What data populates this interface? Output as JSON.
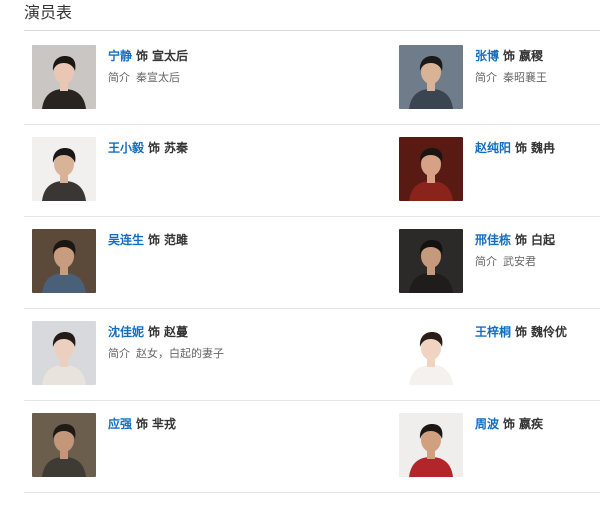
{
  "header": {
    "title": "演员表"
  },
  "connector": "饰",
  "intro_label": "简介",
  "cast": [
    {
      "actor": "宁静",
      "role": "宣太后",
      "intro": "秦宣太后",
      "photo": {
        "bg": "#c9c6c4",
        "skin": "#e9c7b4",
        "hair": "#1d1714",
        "cloth": "#2a2420"
      }
    },
    {
      "actor": "张博",
      "role": "嬴稷",
      "intro": "秦昭襄王",
      "photo": {
        "bg": "#6f7c8a",
        "skin": "#d9b395",
        "hair": "#1c1a19",
        "cloth": "#3b4552"
      }
    },
    {
      "actor": "王小毅",
      "role": "苏秦",
      "intro": "",
      "photo": {
        "bg": "#f1f0ee",
        "skin": "#d8b397",
        "hair": "#1a1817",
        "cloth": "#3a3633"
      }
    },
    {
      "actor": "赵纯阳",
      "role": "魏冉",
      "intro": "",
      "photo": {
        "bg": "#5a1a14",
        "skin": "#d6a184",
        "hair": "#1a1512",
        "cloth": "#8a231b"
      }
    },
    {
      "actor": "吴连生",
      "role": "范雎",
      "intro": "",
      "photo": {
        "bg": "#5b4a3a",
        "skin": "#c79c7f",
        "hair": "#1c1713",
        "cloth": "#4a5f78"
      }
    },
    {
      "actor": "邢佳栋",
      "role": "白起",
      "intro": "武安君",
      "photo": {
        "bg": "#2b2a28",
        "skin": "#c59a7c",
        "hair": "#141210",
        "cloth": "#1f1d1b"
      }
    },
    {
      "actor": "沈佳妮",
      "role": "赵蔓",
      "intro": "赵女，白起的妻子",
      "photo": {
        "bg": "#d7d9dc",
        "skin": "#ecd0bf",
        "hair": "#221b18",
        "cloth": "#e8e3dc"
      }
    },
    {
      "actor": "王梓桐",
      "role": "魏伶优",
      "intro": "",
      "photo": {
        "bg": "#ffffff",
        "skin": "#f1d3c2",
        "hair": "#2a1d17",
        "cloth": "#f4f1ee"
      }
    },
    {
      "actor": "应强",
      "role": "芈戎",
      "intro": "",
      "photo": {
        "bg": "#6b5e4d",
        "skin": "#c4977a",
        "hair": "#1e1a16",
        "cloth": "#3e3a34"
      }
    },
    {
      "actor": "周波",
      "role": "嬴疾",
      "intro": "",
      "photo": {
        "bg": "#efeeec",
        "skin": "#d1a07f",
        "hair": "#1b1714",
        "cloth": "#b2262a"
      }
    }
  ]
}
